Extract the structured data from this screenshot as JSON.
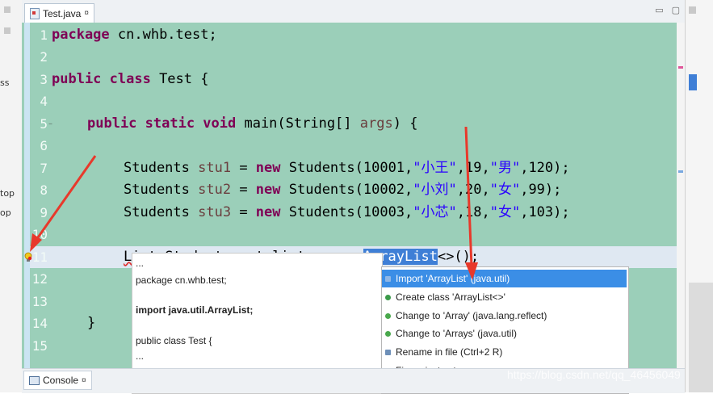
{
  "editor": {
    "tab_label": "Test.java",
    "tab_close": "¤",
    "window_buttons": [
      "▭",
      "▢"
    ],
    "lines": [
      {
        "n": "1"
      },
      {
        "n": "2"
      },
      {
        "n": "3"
      },
      {
        "n": "4"
      },
      {
        "n": "5"
      },
      {
        "n": "6"
      },
      {
        "n": "7"
      },
      {
        "n": "8"
      },
      {
        "n": "9"
      },
      {
        "n": "10"
      },
      {
        "n": "11"
      },
      {
        "n": "12"
      },
      {
        "n": "13"
      },
      {
        "n": "14"
      },
      {
        "n": "15"
      }
    ],
    "code": {
      "l1_kw": "package",
      "l1_rest": " cn.whb.test;",
      "l3_kw": "public class",
      "l3_rest": " Test {",
      "l5_kw": "public static void",
      "l5_mid": " main(String[] ",
      "l5_var": "args",
      "l5_end": ") {",
      "l7_type": "Students ",
      "l7_var": "stu1",
      "l7_eq": " = ",
      "l7_new": "new",
      "l7_call": " Students(10001,",
      "l7_s1": "\"小王\"",
      "l7_n1": ",19,",
      "l7_s2": "\"男\"",
      "l7_end": ",120);",
      "l8_type": "Students ",
      "l8_var": "stu2",
      "l8_eq": " = ",
      "l8_new": "new",
      "l8_call": " Students(10002,",
      "l8_s1": "\"小刘\"",
      "l8_n1": ",20,",
      "l8_s2": "\"女\"",
      "l8_end": ",99);",
      "l9_type": "Students ",
      "l9_var": "stu3",
      "l9_eq": " = ",
      "l9_new": "new",
      "l9_call": " Students(10003,",
      "l9_s1": "\"小芯\"",
      "l9_n1": ",18,",
      "l9_s2": "\"女\"",
      "l9_end": ",103);",
      "l11_err": "List",
      "l11_mid": "<Students> stulist = new ",
      "l11_hl": "ArrayList",
      "l11_end": "<>();",
      "l14": "}"
    }
  },
  "quickfix": {
    "items": [
      {
        "label": "Import 'ArrayList' (java.util)",
        "icon": "import-icon"
      },
      {
        "label": "Create class 'ArrayList<>'",
        "icon": "create-class-icon"
      },
      {
        "label": "Change to 'Array' (java.lang.reflect)",
        "icon": "change-icon"
      },
      {
        "label": "Change to 'Arrays' (java.util)",
        "icon": "change-icon"
      },
      {
        "label": "Rename in file (Ctrl+2 R)",
        "icon": "rename-icon"
      },
      {
        "label": "Fix project setup...",
        "icon": "fix-setup-icon"
      }
    ],
    "preview": {
      "line1": "...",
      "line2": "package cn.whb.test;",
      "line3": "import java.util.ArrayList;",
      "line4": "public class Test {",
      "line5": "..."
    }
  },
  "console": {
    "tab_label": "Console",
    "tab_close": "¤"
  },
  "left_fragments": {
    "f1": "ss",
    "f2": "top",
    "f3": "op"
  },
  "watermark": "https://blog.csdn.net/qq_46456049",
  "colors": {
    "editor_bg": "#9bcfb9",
    "keyword": "#7f0055",
    "string": "#2a00ff",
    "variable": "#6a3e3e",
    "selection": "#3b8ee6",
    "annotation_arrow": "#e8392b"
  }
}
